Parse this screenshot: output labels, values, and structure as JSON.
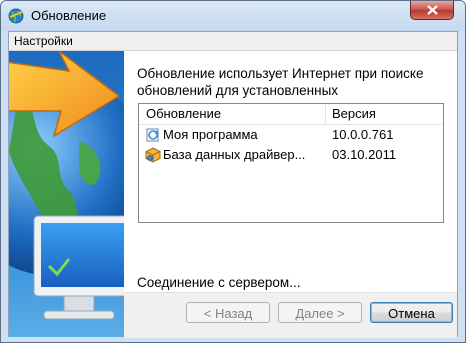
{
  "window": {
    "title": "Обновление"
  },
  "menu": {
    "items": [
      {
        "label": "Настройки"
      }
    ]
  },
  "content": {
    "description": "Обновление использует Интернет при поиске обновлений для установленных",
    "list": {
      "columns": [
        "Обновление",
        "Версия"
      ],
      "rows": [
        {
          "icon": "program-update-icon",
          "name": "Моя программа",
          "version": "10.0.0.761"
        },
        {
          "icon": "driver-database-icon",
          "name": "База данных драйвер...",
          "version": "03.10.2011"
        }
      ]
    },
    "status": "Соединение с сервером..."
  },
  "buttons": {
    "back": "< Назад",
    "next": "Далее >",
    "cancel": "Отмена"
  },
  "colors": {
    "titlebar": "#c4d8ef",
    "close": "#c75050",
    "banner": "#2d86d8",
    "default_button_border": "#3c7fb1"
  }
}
